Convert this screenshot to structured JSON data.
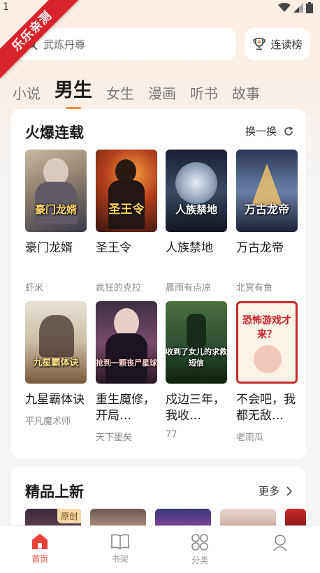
{
  "status": {
    "time": "1"
  },
  "watermark": "乐乐亲测",
  "search": {
    "placeholder": "武炼丹尊"
  },
  "rank_button": {
    "label": "连读榜"
  },
  "tabs": [
    {
      "label": "小说"
    },
    {
      "label": "男生"
    },
    {
      "label": "女生"
    },
    {
      "label": "漫画"
    },
    {
      "label": "听书"
    },
    {
      "label": "故事"
    }
  ],
  "hot_section": {
    "title": "火爆连载",
    "refresh_label": "换一换",
    "books": [
      {
        "name": "豪门龙婿",
        "author": "虾米",
        "cover_text": "豪门龙婿"
      },
      {
        "name": "圣王令",
        "author": "疯狂的克拉",
        "cover_text": "圣王令"
      },
      {
        "name": "人族禁地",
        "author": "晨雨有点凉",
        "cover_text": "人族禁地"
      },
      {
        "name": "万古龙帝",
        "author": "北冥有鱼",
        "cover_text": "万古龙帝"
      },
      {
        "name": "九星霸体诀",
        "author": "平凡魔术师",
        "cover_text": "九星霸体诀"
      },
      {
        "name": "重生魔修，开局…",
        "author": "天下墨矣",
        "cover_text": "抢到一颗丧尸星球"
      },
      {
        "name": "戍边三年，我收…",
        "author": "77",
        "cover_text": "收到了女儿的求救短信"
      },
      {
        "name": "不会吧，我都无敌…",
        "author": "老南瓜",
        "cover_text": "恐怖游戏才来？"
      }
    ]
  },
  "new_section": {
    "title": "精品上新",
    "more_label": "更多",
    "badge": "原创"
  },
  "bottom_nav": [
    {
      "label": "首页"
    },
    {
      "label": "书架"
    },
    {
      "label": "分类"
    },
    {
      "label": ""
    }
  ],
  "colors": {
    "accent": "#e8423a",
    "tab_indicator": "#f08a3c",
    "ribbon": "#d9232c"
  }
}
